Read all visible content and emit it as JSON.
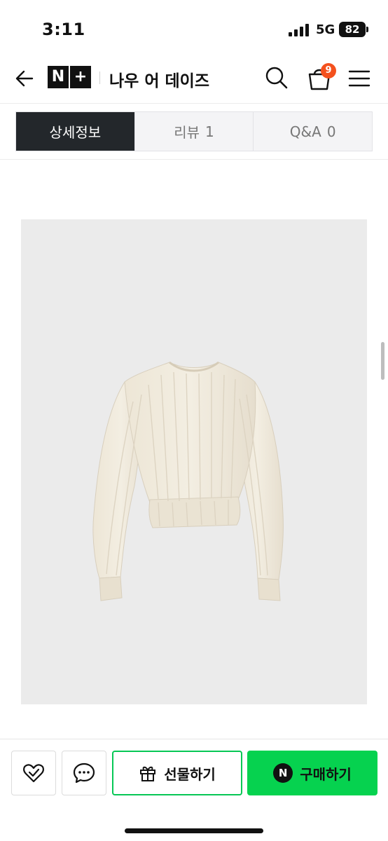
{
  "status_bar": {
    "time": "3:11",
    "network": "5G",
    "battery": "82"
  },
  "header": {
    "logo_left": "N",
    "logo_right": "+",
    "store_name": "나우 어 데이즈",
    "cart_count": "9"
  },
  "tabs": [
    {
      "label": "상세정보",
      "count": ""
    },
    {
      "label": "리뷰",
      "count": "1"
    },
    {
      "label": "Q&A",
      "count": "0"
    }
  ],
  "bottom_bar": {
    "gift_label": "선물하기",
    "buy_badge": "N",
    "buy_label": "구매하기"
  },
  "colors": {
    "brand_green": "#06d24f",
    "badge_red": "#f4511e",
    "active_tab": "#23272b"
  }
}
